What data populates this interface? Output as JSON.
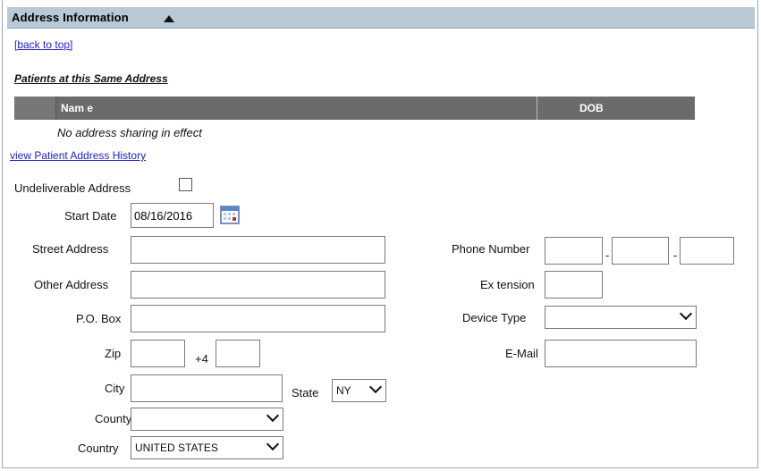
{
  "header": {
    "title": "Address Information"
  },
  "back_link": "[back to top]",
  "patients_section": {
    "title": "Patients at this Same Address",
    "columns": [
      "Nam e",
      "DOB"
    ],
    "empty_message": "No address sharing in effect"
  },
  "history_link": "view  Patient Address History",
  "form": {
    "undeliverable_label": "Undeliverable Address",
    "start_date_label": "Start Date",
    "start_date_value": "08/16/2016",
    "street_label": "Street Address",
    "street_value": "",
    "other_label": "Other Address",
    "other_value": "",
    "pobox_label": "P.O. Box",
    "pobox_value": "",
    "zip_label": "Zip",
    "zip_value": "",
    "plus4_label": "+4",
    "plus4_value": "",
    "city_label": "City",
    "city_value": "",
    "state_label": "State",
    "state_value": "NY",
    "county_label": "County",
    "county_value": "",
    "country_label": "Country",
    "country_value": "UNITED STATES",
    "phone_label": "Phone Number",
    "extension_label": "Ex tension",
    "device_label": "Device Type",
    "device_value": "",
    "email_label": "E-Mail",
    "email_value": ""
  },
  "icons": {
    "calendar": "calendar-icon",
    "collapse": "triangle-up-icon",
    "dropdown": "chevron-down-icon"
  }
}
